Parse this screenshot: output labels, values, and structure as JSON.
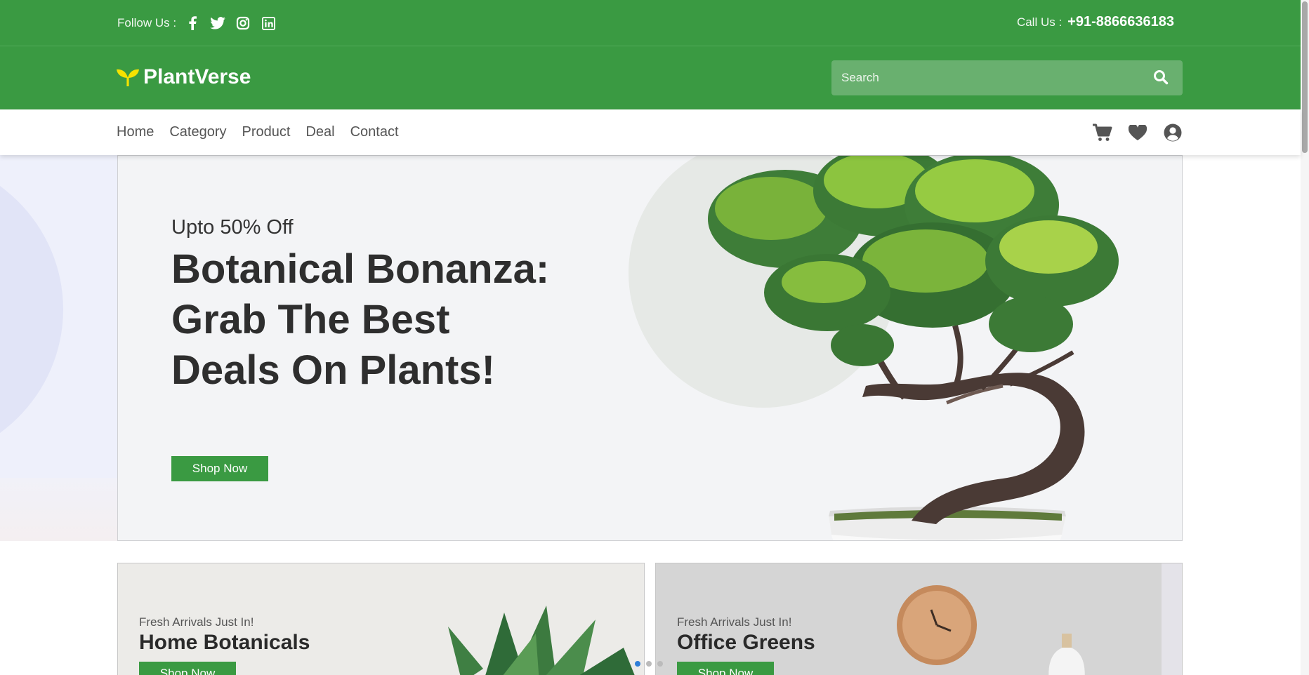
{
  "topbar": {
    "follow_label": "Follow Us :",
    "social": [
      "facebook-icon",
      "twitter-icon",
      "instagram-icon",
      "linkedin-icon"
    ],
    "call_label": "Call Us :",
    "phone": "+91-8866636183"
  },
  "header": {
    "brand": "PlantVerse",
    "search_placeholder": "Search"
  },
  "nav": {
    "items": [
      "Home",
      "Category",
      "Product",
      "Deal",
      "Contact"
    ],
    "icons": [
      "cart-icon",
      "heart-icon",
      "user-icon"
    ]
  },
  "hero": {
    "kicker": "Upto 50% Off",
    "title": "Botanical Bonanza: Grab The Best Deals On Plants!",
    "cta": "Shop Now"
  },
  "cards": [
    {
      "kicker": "Fresh Arrivals Just In!",
      "title": "Home Botanicals",
      "cta": "Shop Now"
    },
    {
      "kicker": "Fresh Arrivals Just In!",
      "title": "Office Greens",
      "cta": "Shop Now"
    }
  ],
  "colors": {
    "brand_green": "#3a9a42",
    "active_dot": "#2f7ed8"
  }
}
